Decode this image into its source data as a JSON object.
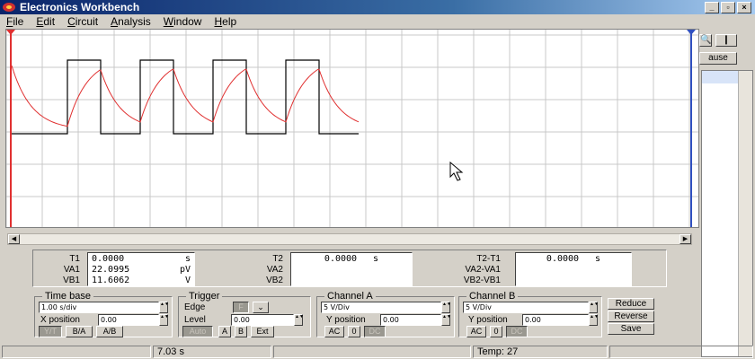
{
  "window": {
    "title": "Electronics Workbench",
    "controls": [
      "_",
      "▫",
      "×"
    ]
  },
  "menu": [
    {
      "label": "File",
      "ul": "F",
      "rest": "ile"
    },
    {
      "label": "Edit",
      "ul": "E",
      "rest": "dit"
    },
    {
      "label": "Circuit",
      "ul": "C",
      "rest": "ircuit"
    },
    {
      "label": "Analysis",
      "ul": "A",
      "rest": "nalysis"
    },
    {
      "label": "Window",
      "ul": "W",
      "rest": "indow"
    },
    {
      "label": "Help",
      "ul": "H",
      "rest": "elp"
    }
  ],
  "colors": {
    "channel_a_trace": "#e03030",
    "channel_b_trace": "#000000",
    "cursor1": "#e03030",
    "cursor2": "#3050c0",
    "grid": "#c8c8c8"
  },
  "background_panel": {
    "pause_label": "ause",
    "close_label": "×"
  },
  "readouts": {
    "c1": {
      "labels": [
        "T1",
        "VA1",
        "VB1"
      ],
      "rows": [
        [
          "0.0000",
          "s"
        ],
        [
          "22.0995",
          "pV"
        ],
        [
          "11.6062",
          "V"
        ]
      ]
    },
    "c2": {
      "labels": [
        "T2",
        "VA2",
        "VB2"
      ],
      "rows": [
        [
          "0.0000",
          "s"
        ],
        [
          "",
          ""
        ],
        [
          "",
          ""
        ]
      ]
    },
    "diff": {
      "labels": [
        "T2-T1",
        "VA2-VA1",
        "VB2-VB1"
      ],
      "rows": [
        [
          "0.0000",
          "s"
        ],
        [
          "",
          ""
        ],
        [
          "",
          ""
        ]
      ]
    }
  },
  "controls": {
    "timebase": {
      "title": "Time base",
      "scale": "1.00 s/div",
      "xpos_label": "X position",
      "xpos": "0.00",
      "modes": [
        "Y/T",
        "B/A",
        "A/B"
      ],
      "active_mode": "Y/T"
    },
    "trigger": {
      "title": "Trigger",
      "edge_label": "Edge",
      "edge_options": [
        "F",
        "⌄"
      ],
      "level_label": "Level",
      "level": "0.00",
      "sources": [
        "Auto",
        "A",
        "B",
        "Ext"
      ],
      "active_source": "Auto"
    },
    "channel_a": {
      "title": "Channel A",
      "scale": "5 V/Div",
      "ypos_label": "Y position",
      "ypos": "0.00",
      "coupling": [
        "AC",
        "0",
        "DC"
      ],
      "active_coupling": "DC"
    },
    "channel_b": {
      "title": "Channel B",
      "scale": "5 V/Div",
      "ypos_label": "Y position",
      "ypos": "0.00",
      "coupling": [
        "AC",
        "0",
        "DC"
      ],
      "active_coupling": "DC"
    },
    "buttons": {
      "reduce": "Reduce",
      "reverse": "Reverse",
      "save": "Save"
    }
  },
  "status": {
    "time": "7.03 s",
    "temp": "Temp:  27"
  }
}
